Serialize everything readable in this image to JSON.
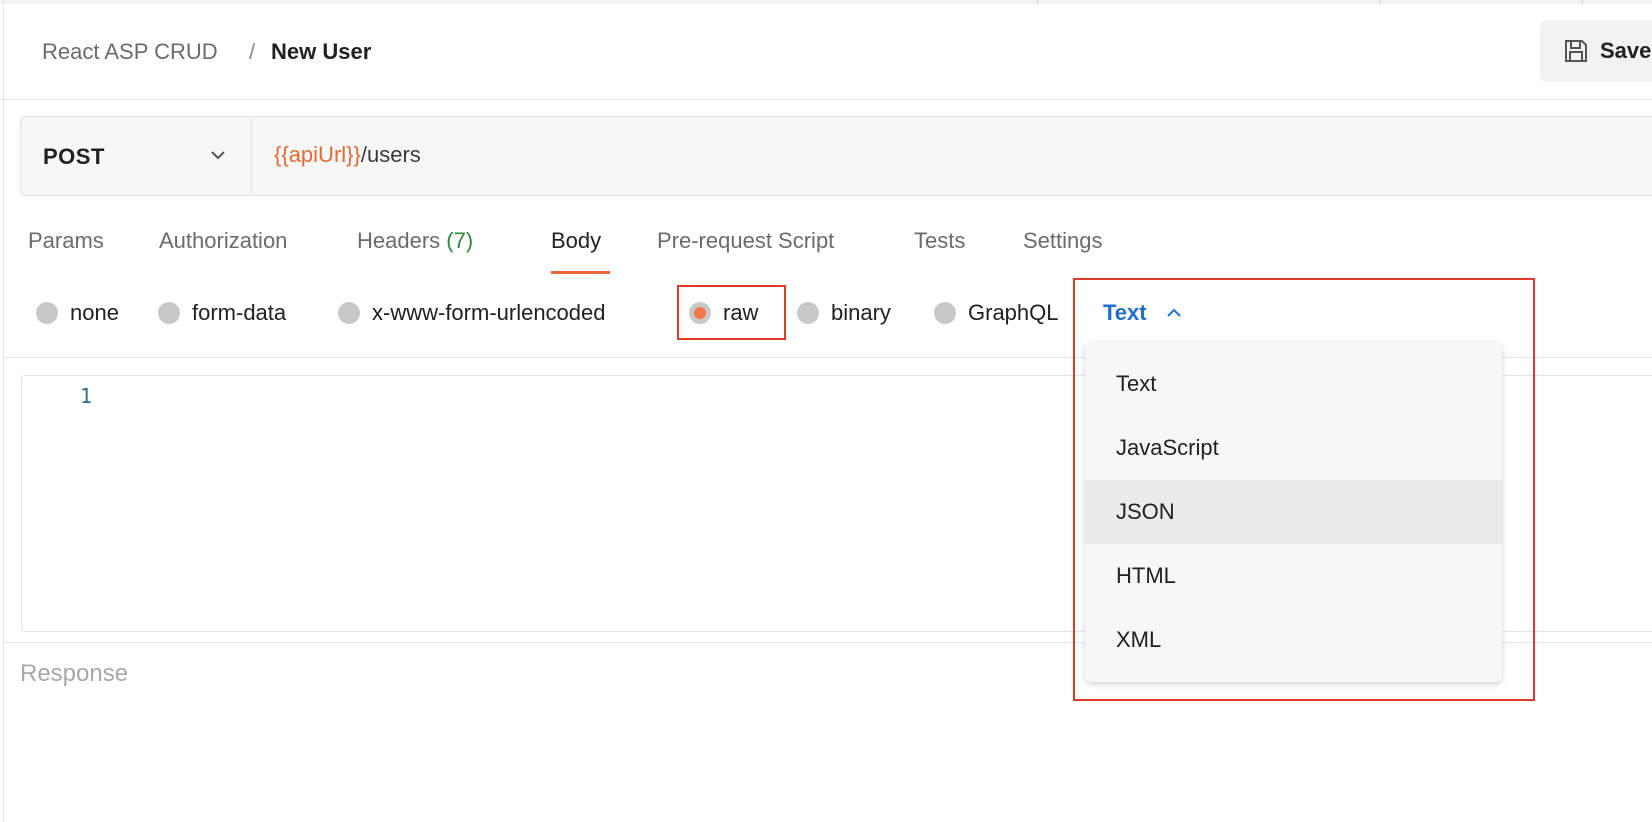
{
  "breadcrumb": {
    "parent": "React ASP CRUD",
    "separator": "/",
    "current": "New User"
  },
  "toolbar": {
    "save_label": "Save"
  },
  "request": {
    "method": "POST",
    "url_variable": "{{apiUrl}}",
    "url_path": "/users"
  },
  "tabs": [
    {
      "label": "Params"
    },
    {
      "label": "Authorization"
    },
    {
      "label": "Headers",
      "count": "(7)"
    },
    {
      "label": "Body"
    },
    {
      "label": "Pre-request Script"
    },
    {
      "label": "Tests"
    },
    {
      "label": "Settings"
    }
  ],
  "active_tab": "Body",
  "body_types": [
    {
      "label": "none"
    },
    {
      "label": "form-data"
    },
    {
      "label": "x-www-form-urlencoded"
    },
    {
      "label": "raw"
    },
    {
      "label": "binary"
    },
    {
      "label": "GraphQL"
    }
  ],
  "selected_body_type": "raw",
  "language_select": {
    "value": "Text",
    "options": [
      "Text",
      "JavaScript",
      "JSON",
      "HTML",
      "XML"
    ],
    "hovered": "JSON"
  },
  "editor": {
    "line_number": "1"
  },
  "response": {
    "label": "Response"
  },
  "colors": {
    "accent": "#e8683a",
    "link_blue": "#1f6fd1",
    "highlight_red": "#e03b28",
    "header_count_green": "#2b8a3e"
  }
}
